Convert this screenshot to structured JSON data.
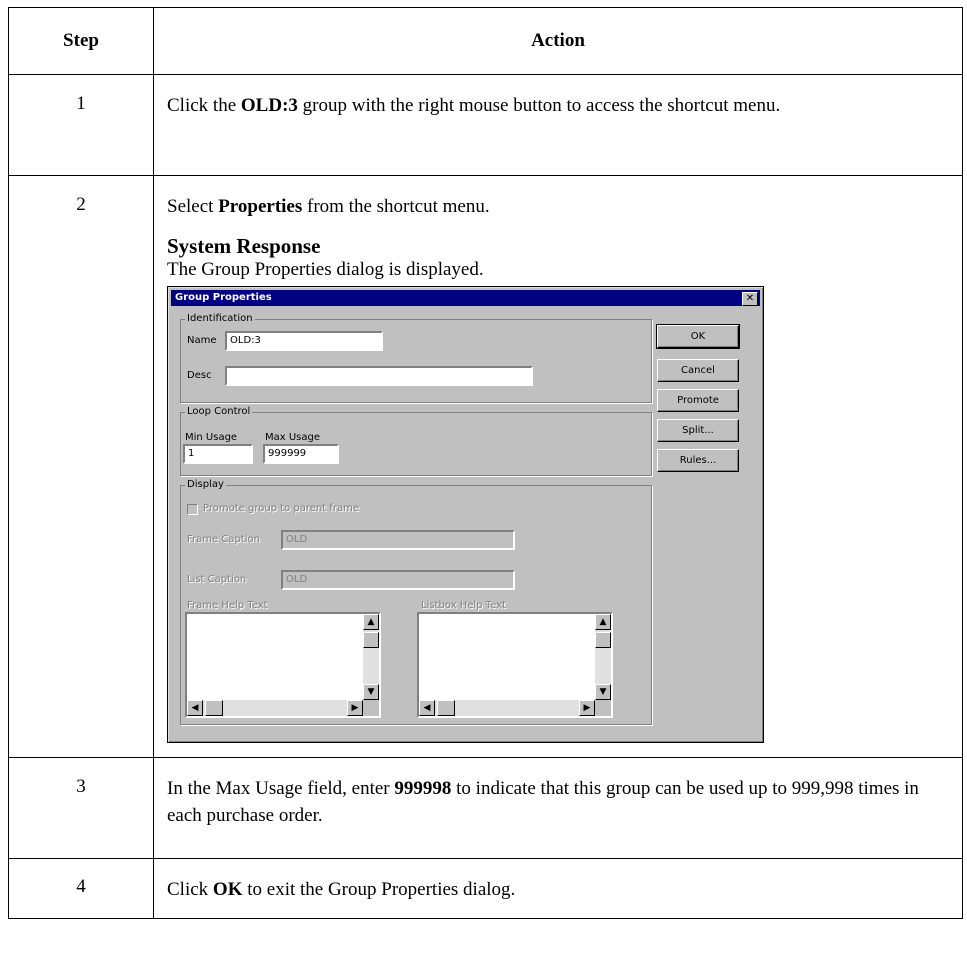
{
  "table": {
    "headers": {
      "step": "Step",
      "action": "Action"
    },
    "rows": [
      {
        "step": "1",
        "pre": "Click the ",
        "bold": "OLD:3",
        "post": " group with the right mouse button to access the shortcut menu."
      },
      {
        "step": "2",
        "pre": "Select ",
        "bold": "Properties",
        "post": " from the shortcut menu."
      },
      {
        "step": "3",
        "pre": "In the Max Usage field, enter ",
        "bold": "999998",
        "post": " to indicate that this group can be used up to 999,998 times in each purchase order."
      },
      {
        "step": "4",
        "pre": "Click ",
        "bold": "OK",
        "post": " to exit the Group Properties dialog."
      }
    ],
    "system_response": {
      "heading": "System Response",
      "text": "The Group Properties dialog is displayed."
    }
  },
  "dialog": {
    "title": "Group Properties",
    "close_glyph": "✕",
    "identification": {
      "label": "Identification",
      "name_label": "Name",
      "name_value": "OLD:3",
      "desc_label": "Desc",
      "desc_value": ""
    },
    "loop_control": {
      "label": "Loop Control",
      "min_label": "Min Usage",
      "min_value": "1",
      "max_label": "Max Usage",
      "max_value": "999999"
    },
    "display": {
      "label": "Display",
      "promote_checkbox_label": "Promote group to parent frame",
      "frame_caption_label": "Frame Caption",
      "frame_caption_value": "OLD",
      "list_caption_label": "List Caption",
      "list_caption_value": "OLD",
      "frame_help_label": "Frame Help Text",
      "listbox_help_label": "Listbox Help Text"
    },
    "buttons": {
      "ok": "OK",
      "cancel": "Cancel",
      "promote": "Promote",
      "split": "Split...",
      "rules": "Rules..."
    },
    "icons": {
      "up": "▲",
      "down": "▼",
      "left": "◀",
      "right": "▶"
    }
  }
}
